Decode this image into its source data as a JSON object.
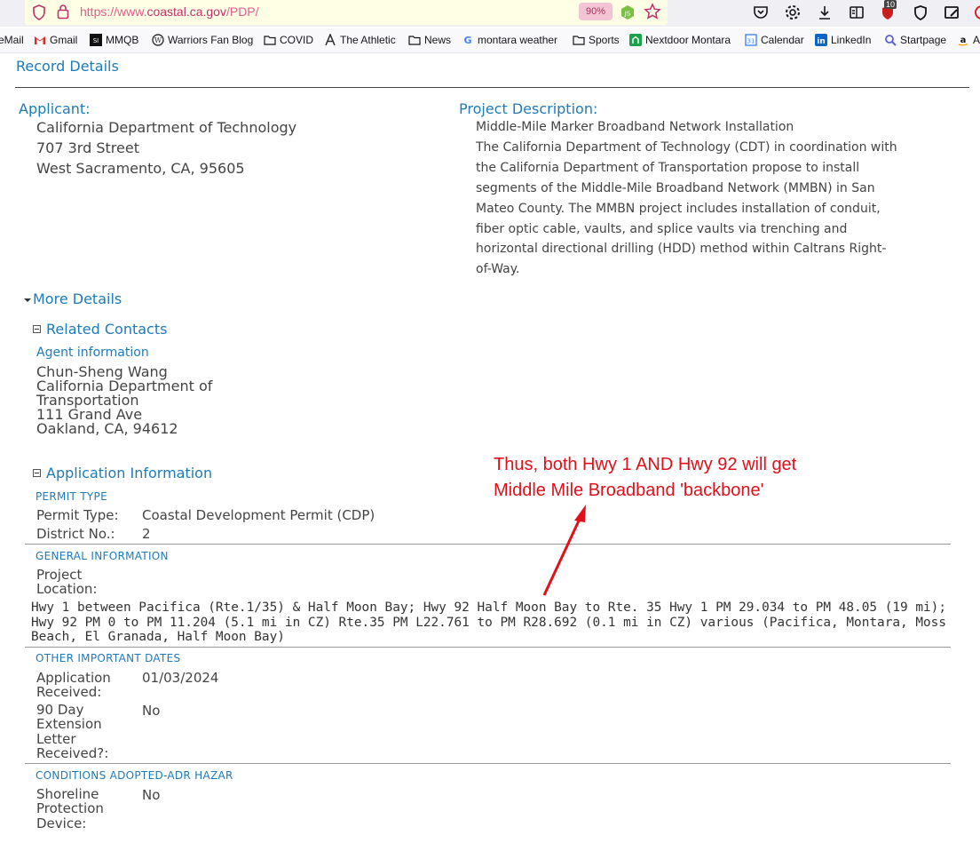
{
  "browser": {
    "url_prefix": "https://www.",
    "url_host": "coastal.ca.gov",
    "url_path": "/PDP/",
    "zoom": "90%",
    "notifications_badge": "10",
    "bookmarks": [
      {
        "label": "eMail",
        "icon": "mail-icon"
      },
      {
        "label": "Gmail",
        "icon": "gmail-icon"
      },
      {
        "label": "MMQB",
        "icon": "si-icon"
      },
      {
        "label": "Warriors Fan Blog",
        "icon": "wordpress-icon"
      },
      {
        "label": "COVID",
        "icon": "folder-icon"
      },
      {
        "label": "The Athletic",
        "icon": "athletic-icon"
      },
      {
        "label": "News",
        "icon": "folder-icon"
      },
      {
        "label": "montara weather",
        "icon": "google-icon"
      },
      {
        "label": "Sports",
        "icon": "folder-icon"
      },
      {
        "label": "Nextdoor Montara",
        "icon": "nextdoor-icon"
      },
      {
        "label": "Calendar",
        "icon": "calendar-icon"
      },
      {
        "label": "LinkedIn",
        "icon": "linkedin-icon"
      },
      {
        "label": "Startpage",
        "icon": "startpage-icon"
      },
      {
        "label": "A",
        "icon": "amazon-icon"
      }
    ]
  },
  "page": {
    "title": "Record Details",
    "applicant": {
      "label": "Applicant:",
      "name": "California Department of Technology",
      "street": "707 3rd Street",
      "city": "West Sacramento, CA, 95605"
    },
    "project": {
      "label": "Project Description:",
      "lines": [
        "Middle-Mile Marker Broadband Network Installation",
        "The California Department of Technology (CDT) in coordination with",
        "the California Department of Transportation propose to install",
        "segments of the Middle-Mile Broadband Network (MMBN) in San",
        "Mateo County. The MMBN project includes installation of conduit,",
        "fiber optic cable, vaults, and splice vaults via trenching and",
        "horizontal directional drilling (HDD) method within Caltrans Right-",
        "of-Way."
      ]
    },
    "more_details": "More Details",
    "related_contacts": {
      "header": "Related Contacts",
      "agent_label": "Agent information",
      "lines": [
        "Chun-Sheng Wang",
        "California Department of",
        "Transportation",
        "111 Grand Ave",
        "Oakland, CA, 94612"
      ]
    },
    "application_info": {
      "header": "Application Information",
      "permit_type_header": "PERMIT TYPE",
      "permit_type_label": "Permit Type:",
      "permit_type_value": "Coastal Development Permit (CDP)",
      "district_label": "District No.:",
      "district_value": "2",
      "general_header": "GENERAL INFORMATION",
      "location_label_1": "Project",
      "location_label_2": "Location:",
      "location_value": "Hwy 1 between Pacifica (Rte.1/35) & Half Moon Bay; Hwy 92 Half Moon Bay to Rte. 35 Hwy 1 PM 29.034 to PM 48.05 (19 mi); Hwy 92 PM 0 to PM 11.204 (5.1 mi in CZ) Rte.35 PM L22.761 to PM R28.692 (0.1 mi in CZ) various (Pacifica, Montara, Moss Beach, El Granada, Half Moon Bay)",
      "dates_header": "OTHER IMPORTANT DATES",
      "received_label_1": "Application",
      "received_label_2": "Received:",
      "received_value": "01/03/2024",
      "ext_label_1": "90 Day",
      "ext_label_2": "Extension",
      "ext_label_3": "Letter",
      "ext_label_4": "Received?:",
      "ext_value": "No",
      "conditions_header": "CONDITIONS ADOPTED-ADR HAZAR",
      "shore_label_1": "Shoreline",
      "shore_label_2": "Protection",
      "shore_label_3": "Device:",
      "shore_value": "No"
    }
  },
  "annotation": {
    "line1": "Thus, both Hwy 1 AND Hwy 92 will get",
    "line2": "Middle Mile Broadband 'backbone'",
    "color": "#e0101a"
  }
}
